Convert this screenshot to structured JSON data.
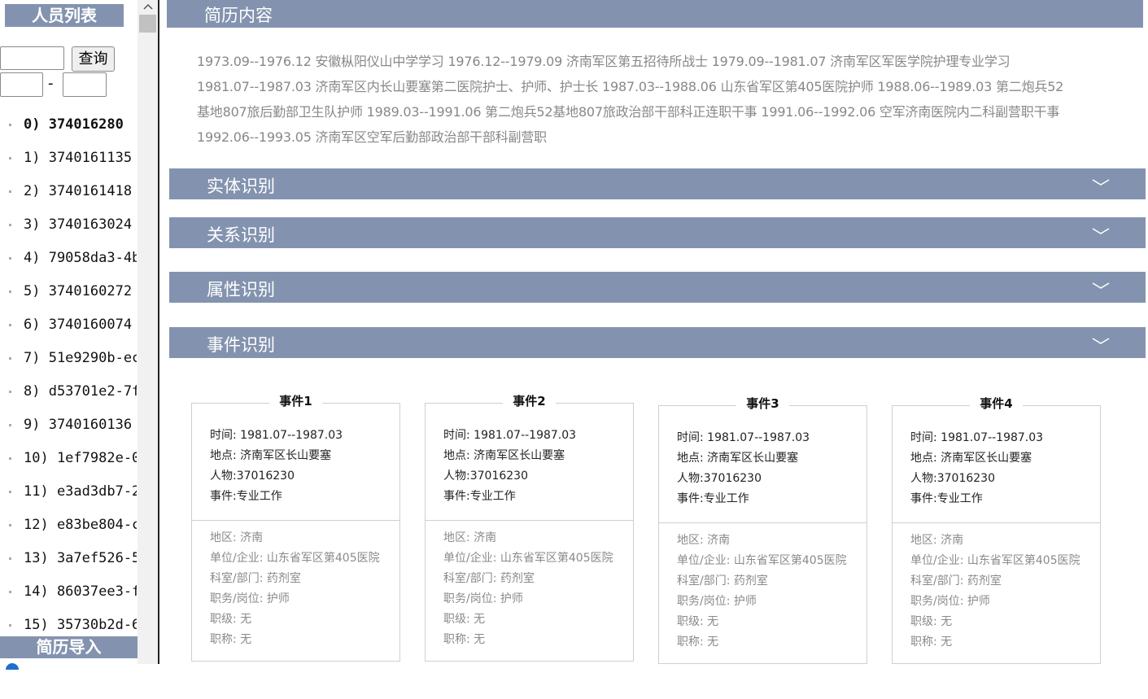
{
  "sidebar": {
    "title": "人员列表",
    "search_button": "查询",
    "range_sep": "-",
    "import_label": "简历导入",
    "items": [
      "0) 374016280",
      "1) 3740161135",
      "2) 3740161418",
      "3) 3740163024",
      "4) 79058da3-4b",
      "5) 3740160272",
      "6) 3740160074",
      "7) 51e9290b-ec",
      "8) d53701e2-7f",
      "9) 3740160136",
      "10) 1ef7982e-0",
      "11) e3ad3db7-2",
      "12) e83be804-c",
      "13) 3a7ef526-5",
      "14) 86037ee3-f",
      "15) 35730b2d-6"
    ]
  },
  "resume": {
    "header": "简历内容",
    "text": "1973.09--1976.12 安徽枞阳仪山中学学习 1976.12--1979.09 济南军区第五招待所战士 1979.09--1981.07 济南军区军医学院护理专业学习 1981.07--1987.03 济南军区内长山要塞第二医院护士、护师、护士长 1987.03--1988.06 山东省军区第405医院护师 1988.06--1989.03 第二炮兵52基地807旅后勤部卫生队护师 1989.03--1991.06 第二炮兵52基地807旅政治部干部科正连职干事 1991.06--1992.06 空军济南医院内二科副营职干事 1992.06--1993.05 济南军区空军后勤部政治部干部科副营职"
  },
  "sections": {
    "entity": "实体识别",
    "relation": "关系识别",
    "attribute": "属性识别",
    "event": "事件识别"
  },
  "events": [
    {
      "title": "事件1",
      "time_label": "时间:",
      "time": "1981.07--1987.03",
      "place_label": "地点:",
      "place": "济南军区长山要塞",
      "person_label": "人物:",
      "person": "37016230",
      "event_label": "事件:",
      "event": "专业工作",
      "region_label": "地区:",
      "region": "济南",
      "org_label": "单位/企业:",
      "org": "山东省军区第405医院",
      "dept_label": "科室/部门:",
      "dept": "药剂室",
      "post_label": "职务/岗位:",
      "post": "护师",
      "level_label": "职级:",
      "level": "无",
      "titlepro_label": "职称:",
      "titlepro": "无"
    },
    {
      "title": "事件2",
      "time_label": "时间:",
      "time": "1981.07--1987.03",
      "place_label": "地点:",
      "place": "济南军区长山要塞",
      "person_label": "人物:",
      "person": "37016230",
      "event_label": "事件:",
      "event": "专业工作",
      "region_label": "地区:",
      "region": "济南",
      "org_label": "单位/企业:",
      "org": "山东省军区第405医院",
      "dept_label": "科室/部门:",
      "dept": "药剂室",
      "post_label": "职务/岗位:",
      "post": "护师",
      "level_label": "职级:",
      "level": "无",
      "titlepro_label": "职称:",
      "titlepro": "无"
    },
    {
      "title": "事件3",
      "time_label": "时间:",
      "time": "1981.07--1987.03",
      "place_label": "地点:",
      "place": "济南军区长山要塞",
      "person_label": "人物:",
      "person": "37016230",
      "event_label": "事件:",
      "event": "专业工作",
      "region_label": "地区:",
      "region": "济南",
      "org_label": "单位/企业:",
      "org": "山东省军区第405医院",
      "dept_label": "科室/部门:",
      "dept": "药剂室",
      "post_label": "职务/岗位:",
      "post": "护师",
      "level_label": "职级:",
      "level": "无",
      "titlepro_label": "职称:",
      "titlepro": "无"
    },
    {
      "title": "事件4",
      "time_label": "时间:",
      "time": "1981.07--1987.03",
      "place_label": "地点:",
      "place": "济南军区长山要塞",
      "person_label": "人物:",
      "person": "37016230",
      "event_label": "事件:",
      "event": "专业工作",
      "region_label": "地区:",
      "region": "济南",
      "org_label": "单位/企业:",
      "org": "山东省军区第405医院",
      "dept_label": "科室/部门:",
      "dept": "药剂室",
      "post_label": "职务/岗位:",
      "post": "护师",
      "level_label": "职级:",
      "level": "无",
      "titlepro_label": "职称:",
      "titlepro": "无"
    }
  ],
  "icons": {
    "expand": "chevron-down-icon",
    "scroll_up": "arrow-up-icon"
  },
  "colors": {
    "header_bg": "#8393af",
    "header_text": "#ffffff",
    "muted_text": "#888888"
  }
}
